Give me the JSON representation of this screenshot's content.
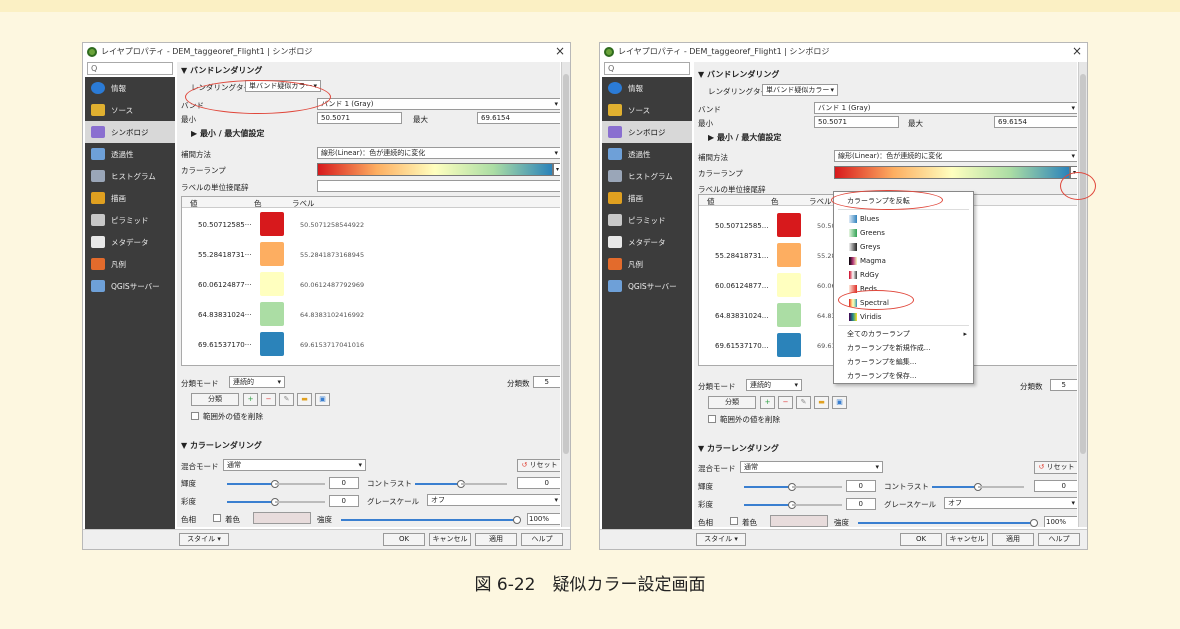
{
  "caption": "図 6-22　疑似カラー設定画面",
  "window": {
    "title": "レイヤプロパティ - DEM_taggeoref_Flight1 | シンボロジ",
    "close": "×",
    "search_placeholder": "Q"
  },
  "sidebar": {
    "items": [
      {
        "label": "情報",
        "icon": "info-icon",
        "color": "#2b7bd6"
      },
      {
        "label": "ソース",
        "icon": "source-icon",
        "color": "#e0b030"
      },
      {
        "label": "シンボロジ",
        "icon": "symbology-icon",
        "color": "#8a6fd0"
      },
      {
        "label": "透過性",
        "icon": "transparency-icon",
        "color": "#6ea0d8"
      },
      {
        "label": "ヒストグラム",
        "icon": "histogram-icon",
        "color": "#9aa6b8"
      },
      {
        "label": "描画",
        "icon": "rendering-icon",
        "color": "#e0a020"
      },
      {
        "label": "ピラミッド",
        "icon": "pyramid-icon",
        "color": "#c8c8c8"
      },
      {
        "label": "メタデータ",
        "icon": "metadata-icon",
        "color": "#e8e8e8"
      },
      {
        "label": "凡例",
        "icon": "legend-icon",
        "color": "#e36b2c"
      },
      {
        "label": "QGISサーバー",
        "icon": "qgis-server-icon",
        "color": "#6ea0d8"
      }
    ]
  },
  "band_rendering": {
    "header": "▼ バンドレンダリング",
    "render_type_label": "レンダリングタイプ",
    "render_type_value": "単バンド疑似カラー",
    "band_label": "バンド",
    "band_value": "バンド 1 (Gray)",
    "min_label": "最小",
    "min_value": "50.5071",
    "max_label": "最大",
    "max_value": "69.6154",
    "minmax_header": "▶ 最小 / 最大値設定",
    "interp_label": "補間方法",
    "interp_value": "線形(Linear)：色が連続的に変化",
    "ramp_label": "カラーランプ",
    "unit_label": "ラベルの単位接尾辞",
    "table_headers": {
      "value": "値",
      "color": "色",
      "label": "ラベル"
    },
    "classes": [
      {
        "value": "50.50712585···",
        "color": "#d7191c",
        "label": "50.5071258544922"
      },
      {
        "value": "55.28418731···",
        "color": "#fdae61",
        "label": "55.2841873168945"
      },
      {
        "value": "60.06124877···",
        "color": "#ffffbf",
        "label": "60.0612487792969"
      },
      {
        "value": "64.83831024···",
        "color": "#abdda4",
        "label": "64.8383102416992"
      },
      {
        "value": "69.61537170···",
        "color": "#2b83ba",
        "label": "69.6153717041016"
      }
    ],
    "classes_right": [
      {
        "value": "50.50712585...",
        "label": "50.50"
      },
      {
        "value": "55.28418731...",
        "label": "55.28"
      },
      {
        "value": "60.06124877...",
        "label": "60.06"
      },
      {
        "value": "64.83831024...",
        "label": "64.83"
      },
      {
        "value": "69.61537170...",
        "label": "69.61"
      }
    ],
    "mode_label": "分類モード",
    "mode_value": "連続的",
    "classes_label": "分類数",
    "classes_count": "5",
    "classify_button": "分類",
    "clip_label": "範囲外の値を削除"
  },
  "color_rendering": {
    "header": "▼ カラーレンダリング",
    "blend_label": "混合モード",
    "blend_value": "通常",
    "reset_button": "リセット",
    "brightness_label": "輝度",
    "brightness_value": "0",
    "contrast_label": "コントラスト",
    "contrast_value": "0",
    "saturation_label": "彩度",
    "saturation_value": "0",
    "grayscale_label": "グレースケール",
    "grayscale_value": "オフ",
    "hue_label": "色相",
    "colorize_label": "着色",
    "strength_label": "強度",
    "strength_value": "100%"
  },
  "footer": {
    "style_button": "スタイル",
    "ok": "OK",
    "cancel": "キャンセル",
    "apply": "適用",
    "help": "ヘルプ"
  },
  "ramp_menu": {
    "invert": "カラーランプを反転",
    "ramps": [
      {
        "label": "Blues",
        "color": "#3a7fd0"
      },
      {
        "label": "Greens",
        "color": "#2ea043"
      },
      {
        "label": "Greys",
        "color": "#444444"
      },
      {
        "label": "Magma",
        "color": "#7a1f6e"
      },
      {
        "label": "RdGy",
        "color": "#c0392b"
      },
      {
        "label": "Reds",
        "color": "#e0473b"
      },
      {
        "label": "Spectral",
        "color": "#fdae61"
      },
      {
        "label": "Viridis",
        "color": "#3b528b"
      }
    ],
    "all_ramps": "全てのカラーランプ",
    "create": "カラーランプを新規作成...",
    "edit": "カラーランプを編集...",
    "save": "カラーランプを保存..."
  },
  "highlight_color": "#e0473b"
}
